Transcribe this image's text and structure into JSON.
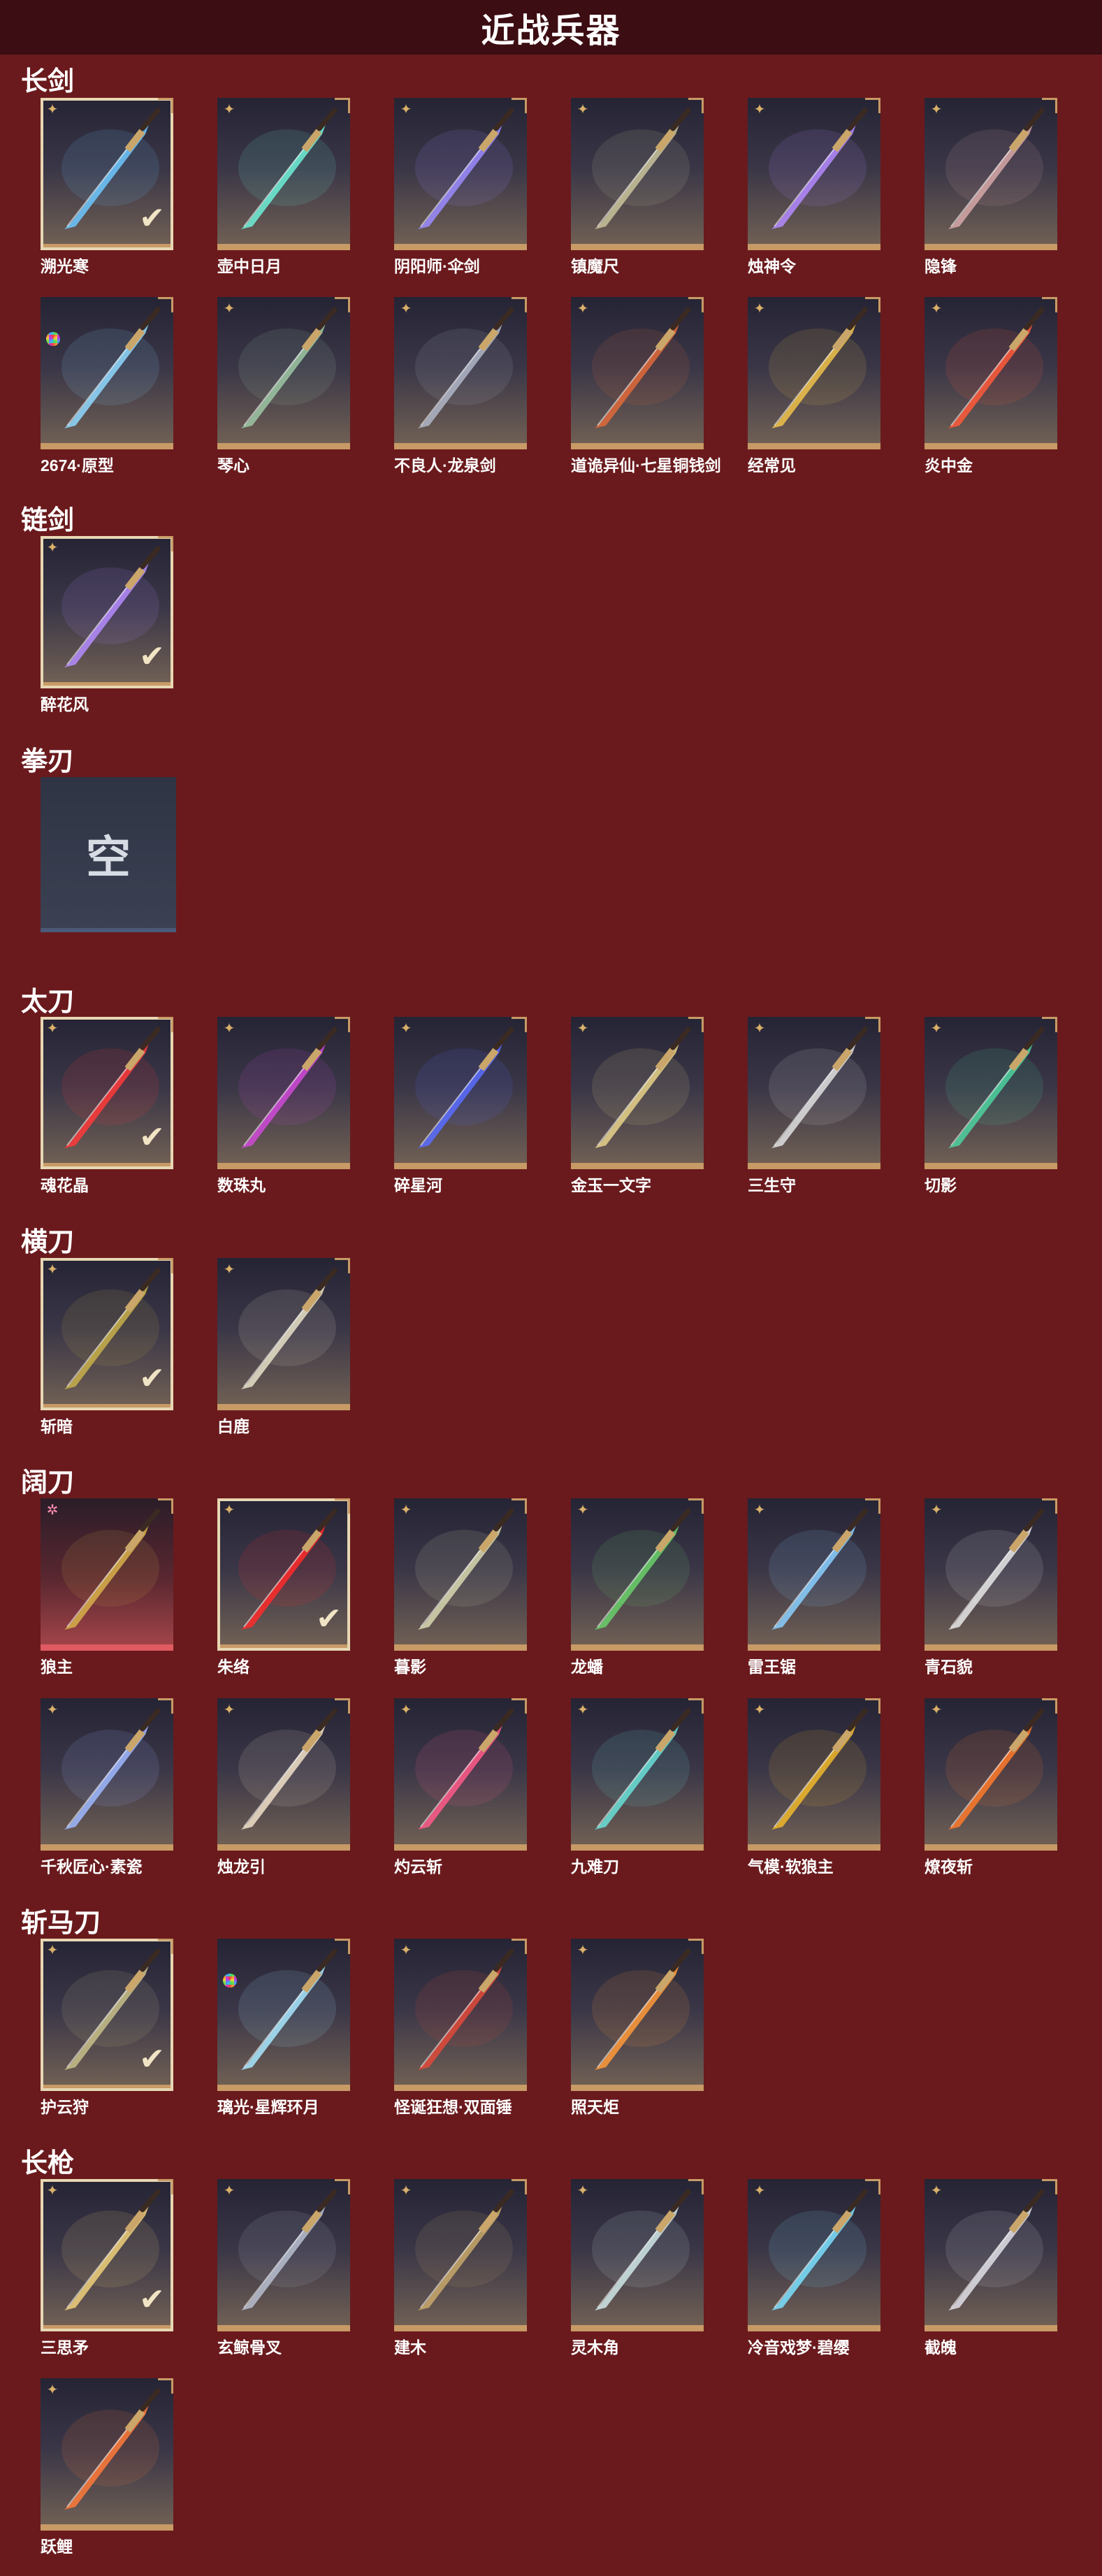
{
  "page": {
    "title": "近战兵器"
  },
  "sections": [
    {
      "title": "长剑",
      "items": [
        {
          "name": "溯光寒",
          "rarity": "gold",
          "selected": true,
          "color": "#6fc8ff"
        },
        {
          "name": "壶中日月",
          "rarity": "gold",
          "color": "#6ff0d8"
        },
        {
          "name": "阴阳师·伞剑",
          "rarity": "gold",
          "color": "#9b8cff"
        },
        {
          "name": "镇魔尺",
          "rarity": "gold",
          "color": "#c9c39b"
        },
        {
          "name": "烛神令",
          "rarity": "gold",
          "color": "#b48aff"
        },
        {
          "name": "隐锋",
          "rarity": "gold",
          "color": "#d7a8a8"
        },
        {
          "name": "2674·原型",
          "rarity": "rainbow",
          "color": "#8fd9ff"
        },
        {
          "name": "琴心",
          "rarity": "gold",
          "color": "#9ec7a5"
        },
        {
          "name": "不良人·龙泉剑",
          "rarity": "gold",
          "color": "#b0b6c8"
        },
        {
          "name": "道诡异仙·七星铜钱剑",
          "rarity": "gold",
          "color": "#e06a3a"
        },
        {
          "name": "经常见",
          "rarity": "gold",
          "color": "#f0c24a"
        },
        {
          "name": "炎中金",
          "rarity": "gold",
          "color": "#ff5a3a"
        }
      ]
    },
    {
      "title": "链剑",
      "items": [
        {
          "name": "醉花风",
          "rarity": "gold",
          "selected": true,
          "color": "#b58cff"
        }
      ]
    },
    {
      "title": "拳刃",
      "empty": true,
      "empty_text": "空"
    },
    {
      "title": "太刀",
      "items": [
        {
          "name": "魂花晶",
          "rarity": "gold",
          "selected": true,
          "color": "#ff3a3a"
        },
        {
          "name": "数珠丸",
          "rarity": "gold",
          "color": "#d04ad8"
        },
        {
          "name": "碎星河",
          "rarity": "gold",
          "color": "#5a6dff"
        },
        {
          "name": "金玉一文字",
          "rarity": "gold",
          "color": "#e8d28a"
        },
        {
          "name": "三生守",
          "rarity": "gold",
          "color": "#e0e0e0"
        },
        {
          "name": "切影",
          "rarity": "gold",
          "color": "#4ed2a0"
        }
      ]
    },
    {
      "title": "横刀",
      "items": [
        {
          "name": "斩暗",
          "rarity": "gold",
          "selected": true,
          "color": "#c8b04a"
        },
        {
          "name": "白鹿",
          "rarity": "gold",
          "color": "#e6e0c8"
        }
      ]
    },
    {
      "title": "阔刀",
      "items": [
        {
          "name": "狼主",
          "rarity": "pink",
          "legend": true,
          "color": "#d8b04a"
        },
        {
          "name": "朱络",
          "rarity": "gold",
          "selected": true,
          "color": "#ff2a2a"
        },
        {
          "name": "暮影",
          "rarity": "gold",
          "color": "#d8d8b0"
        },
        {
          "name": "龙蟠",
          "rarity": "gold",
          "color": "#6ad06a"
        },
        {
          "name": "雷王锯",
          "rarity": "gold",
          "color": "#8ad0ff"
        },
        {
          "name": "青石貌",
          "rarity": "gold",
          "color": "#e8e8e8"
        },
        {
          "name": "千秋匠心·素瓷",
          "rarity": "gold",
          "color": "#9fb8ff"
        },
        {
          "name": "烛龙引",
          "rarity": "gold",
          "color": "#f0e0c8"
        },
        {
          "name": "灼云斩",
          "rarity": "gold",
          "color": "#ff5a8a"
        },
        {
          "name": "九难刀",
          "rarity": "gold",
          "color": "#6ae0d8"
        },
        {
          "name": "气模·软狼主",
          "rarity": "gold",
          "color": "#f0b82a"
        },
        {
          "name": "燎夜斩",
          "rarity": "gold",
          "color": "#ff7a2a"
        }
      ]
    },
    {
      "title": "斩马刀",
      "items": [
        {
          "name": "护云狩",
          "rarity": "gold",
          "selected": true,
          "color": "#c8c08a"
        },
        {
          "name": "璃光·星辉环月",
          "rarity": "rainbow",
          "color": "#a8e8ff"
        },
        {
          "name": "怪诞狂想·双面锤",
          "rarity": "gold",
          "color": "#e04a3a"
        },
        {
          "name": "照天炬",
          "rarity": "gold",
          "color": "#ff9a3a"
        }
      ]
    },
    {
      "title": "长枪",
      "items": [
        {
          "name": "三思矛",
          "rarity": "gold",
          "selected": true,
          "color": "#f0d07a"
        },
        {
          "name": "玄鲸骨叉",
          "rarity": "gold",
          "color": "#b8c0d0"
        },
        {
          "name": "建木",
          "rarity": "gold",
          "color": "#c8a86a"
        },
        {
          "name": "灵木角",
          "rarity": "gold",
          "color": "#d0e8e8"
        },
        {
          "name": "冷音戏梦·碧缨",
          "rarity": "gold",
          "color": "#7ae0ff"
        },
        {
          "name": "截魄",
          "rarity": "gold",
          "color": "#e0e0e8"
        },
        {
          "name": "跃鲤",
          "rarity": "gold",
          "color": "#ff7a3a"
        }
      ]
    }
  ]
}
